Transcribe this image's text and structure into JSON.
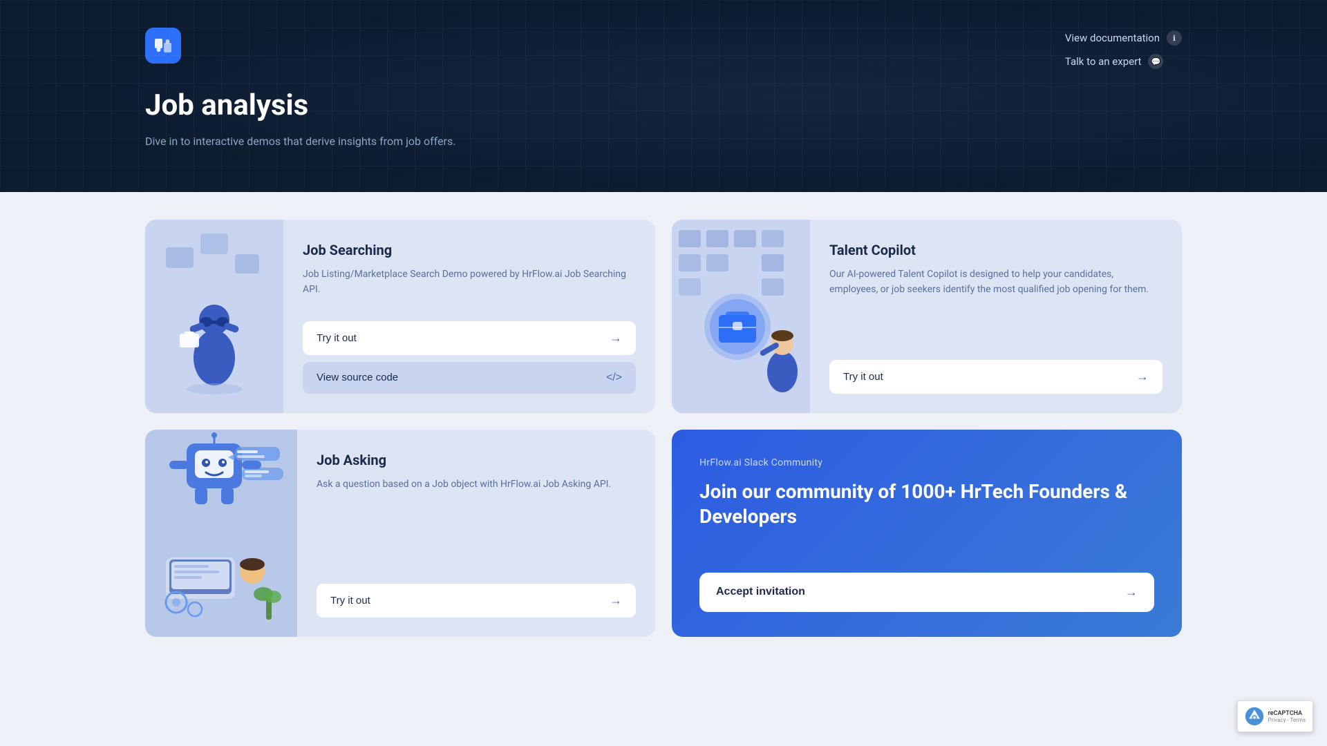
{
  "hero": {
    "title": "Job analysis",
    "subtitle": "Dive in to interactive demos that derive insights from job offers.",
    "nav": {
      "documentation": "View documentation",
      "expert": "Talk to an expert"
    }
  },
  "cards": {
    "job_searching": {
      "title": "Job Searching",
      "description": "Job Listing/Marketplace Search Demo powered by HrFlow.ai Job Searching API.",
      "btn_try": "Try it out",
      "btn_source": "View source code"
    },
    "talent_copilot": {
      "title": "Talent Copilot",
      "description": "Our AI-powered Talent Copilot is designed to help your candidates, employees, or job seekers identify the most qualified job opening for them.",
      "btn_try": "Try it out"
    },
    "job_asking": {
      "title": "Job Asking",
      "description": "Ask a question based on a Job object with HrFlow.ai Job Asking API.",
      "btn_try": "Try it out"
    },
    "slack": {
      "community_label": "HrFlow.ai Slack Community",
      "headline": "Join our community of 1000+ HrTech Founders & Developers",
      "btn_accept": "Accept invitation"
    }
  },
  "recaptcha": {
    "text": "reCAPTCHA",
    "subtext": "Privacy - Terms"
  }
}
